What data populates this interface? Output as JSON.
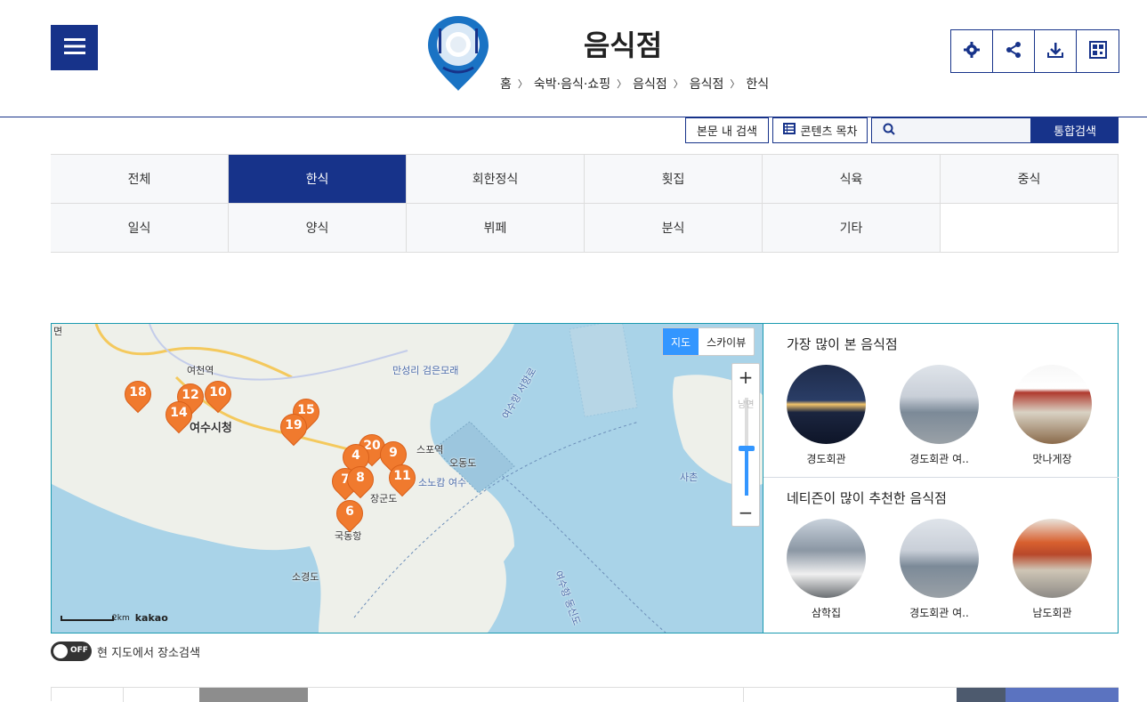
{
  "header": {
    "title": "음식점",
    "breadcrumb": [
      "홈",
      "숙박·음식·쇼핑",
      "음식점",
      "음식점",
      "한식"
    ]
  },
  "search": {
    "inner_search_label": "본문 내 검색",
    "contents_label": "콘텐츠 목차",
    "placeholder": "",
    "submit_label": "통합검색"
  },
  "categories": [
    {
      "label": "전체",
      "active": false
    },
    {
      "label": "한식",
      "active": true
    },
    {
      "label": "회한정식",
      "active": false
    },
    {
      "label": "횟집",
      "active": false
    },
    {
      "label": "식육",
      "active": false
    },
    {
      "label": "중식",
      "active": false
    },
    {
      "label": "일식",
      "active": false
    },
    {
      "label": "양식",
      "active": false
    },
    {
      "label": "뷔페",
      "active": false
    },
    {
      "label": "분식",
      "active": false
    },
    {
      "label": "기타",
      "active": false
    }
  ],
  "map": {
    "type_map_label": "지도",
    "type_sky_label": "스카이뷰",
    "zoom_level_label": "남면",
    "scale_label": "2km",
    "provider": "kakao",
    "places": [
      "여천역",
      "만성리 검은모래",
      "여수시청",
      "오동도",
      "소노캄 여수",
      "장군도",
      "국동항",
      "소경도",
      "사촌",
      "여수항 서항로",
      "여수항 동신도",
      "스포역"
    ],
    "markers": [
      "18",
      "12",
      "10",
      "14",
      "15",
      "19",
      "20",
      "9",
      "4",
      "7",
      "8",
      "11",
      "6"
    ]
  },
  "side": {
    "most_viewed_title": "가장 많이 본 음식점",
    "most_viewed": [
      "경도회관",
      "경도회관 여..",
      "맛나게장"
    ],
    "recommended_title": "네티즌이 많이 추천한 음식점",
    "recommended": [
      "삼학집",
      "경도회관 여..",
      "남도회관"
    ]
  },
  "toggle": {
    "state": "OFF",
    "label": "현 지도에서 장소검색"
  },
  "colors": {
    "primary": "#17338a",
    "map_border": "#1a9ab0",
    "marker": "#f07a2e",
    "zoom_accent": "#3396ff"
  }
}
